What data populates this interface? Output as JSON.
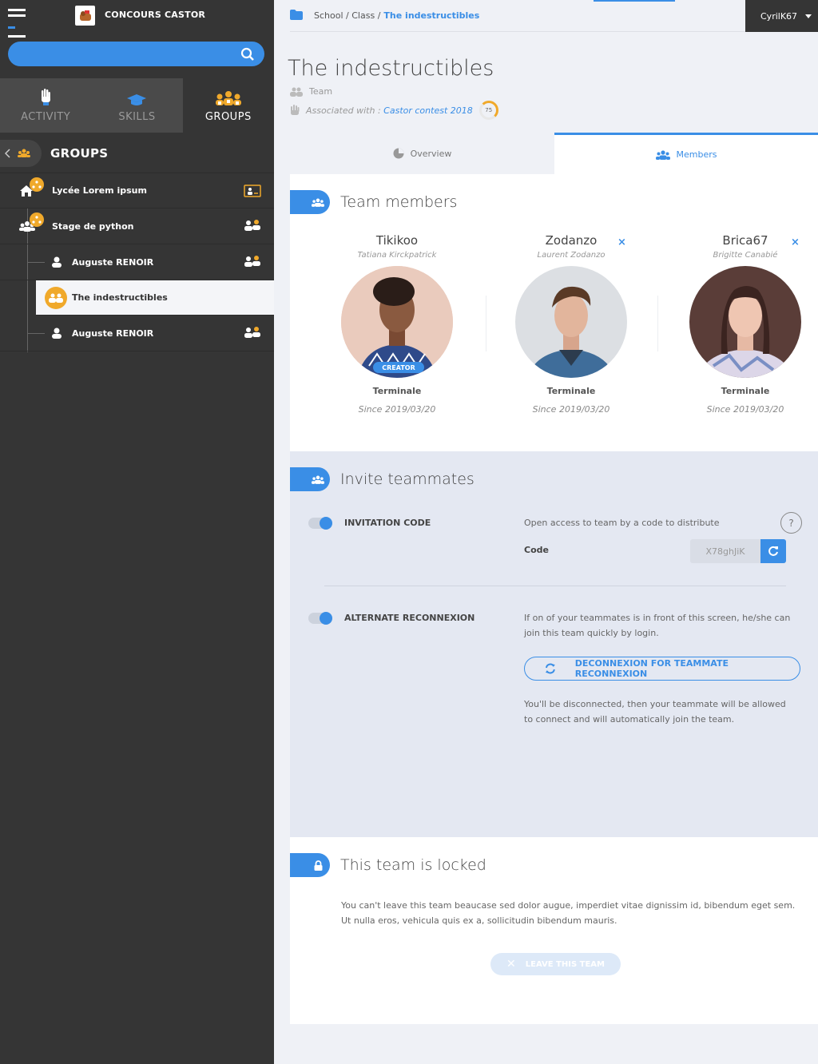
{
  "app": {
    "brand": "CONCOURS CASTOR"
  },
  "sidebar": {
    "tabs": [
      {
        "label": "ACTIVITY",
        "icon": "hand-icon"
      },
      {
        "label": "SKILLS",
        "icon": "graduation-cap-icon"
      },
      {
        "label": "GROUPS",
        "icon": "groups-icon"
      }
    ],
    "groups_title": "GROUPS",
    "tree": [
      {
        "label": "Lycée Lorem ipsum"
      },
      {
        "label": "Stage de python"
      },
      {
        "label": "Auguste RENOIR"
      },
      {
        "label": "The indestructibles"
      },
      {
        "label": "Auguste RENOIR"
      }
    ]
  },
  "breadcrumb": {
    "school": "School",
    "sep1": "/",
    "class": "Class",
    "sep2": "/",
    "current": "The indestructibles"
  },
  "user": {
    "name": "CyrilK67"
  },
  "page": {
    "title": "The indestructibles",
    "type": "Team",
    "assoc_prefix": "Associated with :",
    "assoc_link": "Castor contest 2018",
    "score": "75"
  },
  "tabs": {
    "overview": "Overview",
    "members": "Members"
  },
  "members_section": {
    "title": "Team members",
    "members": [
      {
        "nick": "Tikikoo",
        "name": "Tatiana Kirckpatrick",
        "badge": "CREATOR",
        "level": "Terminale",
        "since": "Since 2019/03/20"
      },
      {
        "nick": "Zodanzo",
        "name": "Laurent Zodanzo",
        "level": "Terminale",
        "since": "Since 2019/03/20",
        "remove": "×"
      },
      {
        "nick": "Brica67",
        "name": "Brigitte Canabié",
        "level": "Terminale",
        "since": "Since 2019/03/20",
        "remove": "×"
      }
    ]
  },
  "invite": {
    "title": "Invite teammates",
    "code_option": "INVITATION CODE",
    "code_desc": "Open access to team by a code to distribute",
    "help": "?",
    "code_label": "Code",
    "code_value": "X78ghJiK",
    "alt_option": "ALTERNATE RECONNEXION",
    "alt_desc": "If on of your teammates is in front of this screen, he/she can join this team quickly by login.",
    "alt_button": "DECONNEXION FOR TEAMMATE RECONNEXION",
    "alt_note": "You'll be disconnected, then your teammate will be allowed to connect and will automatically join the team."
  },
  "locked": {
    "title": "This team is locked",
    "text": "You can't leave this team beaucase sed dolor augue, imperdiet vitae dignissim id, bibendum eget sem. Ut nulla eros, vehicula quis ex a, sollicitudin bibendum mauris.",
    "button": "LEAVE THIS TEAM"
  },
  "colors": {
    "accent": "#3a8ee6",
    "orange": "#f0a92b",
    "sidebar": "#353535"
  }
}
